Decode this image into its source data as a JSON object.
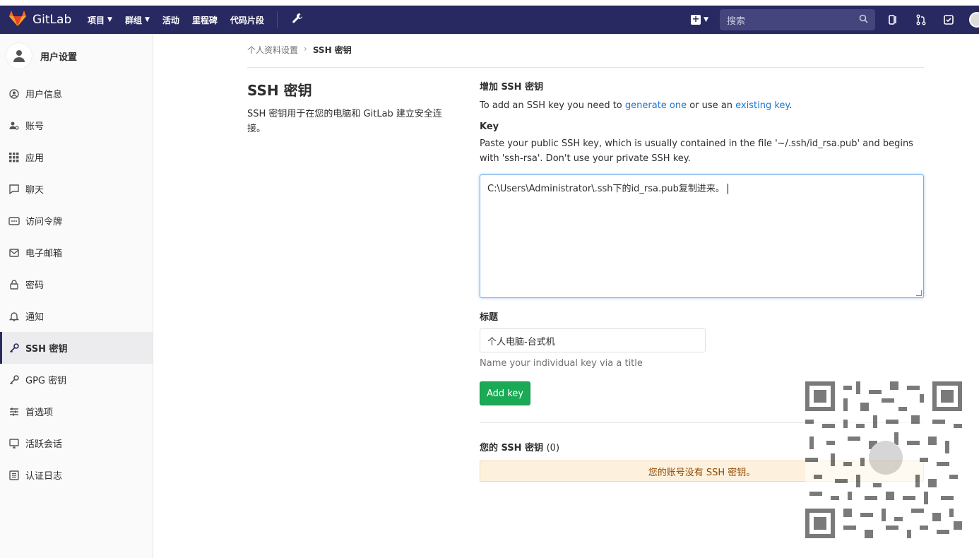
{
  "navbar": {
    "brand": "GitLab",
    "links": [
      {
        "label": "项目",
        "dropdown": true
      },
      {
        "label": "群组",
        "dropdown": true
      },
      {
        "label": "活动",
        "dropdown": false
      },
      {
        "label": "里程碑",
        "dropdown": false
      },
      {
        "label": "代码片段",
        "dropdown": false
      }
    ],
    "search_placeholder": "搜索",
    "icons": [
      "wrench-icon",
      "plus-icon",
      "search-icon",
      "issues-icon",
      "merge-request-icon",
      "todo-icon",
      "avatar"
    ]
  },
  "sidebar": {
    "title": "用户设置",
    "items": [
      {
        "label": "用户信息",
        "icon": "user-circle-icon"
      },
      {
        "label": "账号",
        "icon": "account-icon"
      },
      {
        "label": "应用",
        "icon": "grid-icon"
      },
      {
        "label": "聊天",
        "icon": "chat-icon"
      },
      {
        "label": "访问令牌",
        "icon": "token-icon"
      },
      {
        "label": "电子邮箱",
        "icon": "envelope-icon"
      },
      {
        "label": "密码",
        "icon": "lock-icon"
      },
      {
        "label": "通知",
        "icon": "bell-icon"
      },
      {
        "label": "SSH 密钥",
        "icon": "key-icon",
        "active": true
      },
      {
        "label": "GPG 密钥",
        "icon": "key-icon"
      },
      {
        "label": "首选项",
        "icon": "sliders-icon"
      },
      {
        "label": "活跃会话",
        "icon": "monitor-icon"
      },
      {
        "label": "认证日志",
        "icon": "list-icon"
      }
    ]
  },
  "breadcrumb": {
    "parent": "个人资料设置",
    "current": "SSH 密钥"
  },
  "left": {
    "title": "SSH 密钥",
    "description": "SSH 密钥用于在您的电脑和 GitLab 建立安全连接。"
  },
  "form": {
    "heading": "增加 SSH 密钥",
    "intro_before": "To add an SSH key you need to ",
    "intro_link1": "generate one",
    "intro_middle": " or use an ",
    "intro_link2": "existing key",
    "intro_after": ".",
    "key_label": "Key",
    "key_help": "Paste your public SSH key, which is usually contained in the file '~/.ssh/id_rsa.pub' and begins with 'ssh-rsa'. Don't use your private SSH key.",
    "key_value": "C:\\Users\\Administrator\\.ssh下的id_rsa.pub复制进来。",
    "title_label": "标题",
    "title_value": "个人电脑-台式机",
    "title_hint": "Name your individual key via a title",
    "submit_label": "Add key"
  },
  "keys": {
    "title": "您的 SSH 密钥",
    "count": "(0)",
    "empty_message": "您的账号没有 SSH 密钥。"
  },
  "colors": {
    "navbar": "#292961",
    "link": "#1f78d1",
    "button": "#1aaa55",
    "warning_bg": "#fdf1dd",
    "warning_text": "#8f4700"
  }
}
